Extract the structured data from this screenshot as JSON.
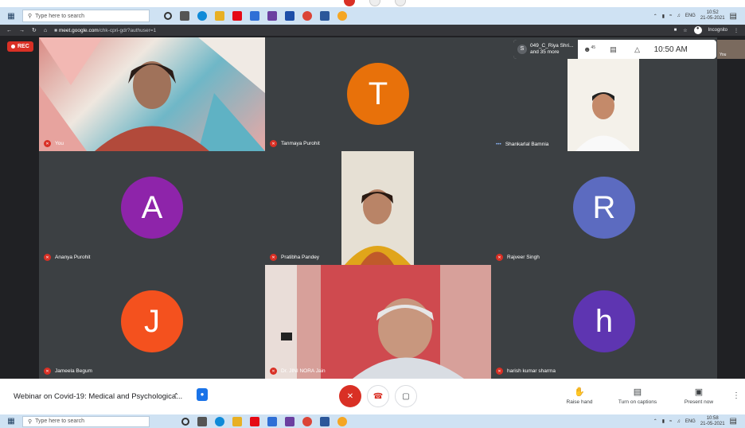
{
  "taskbar": {
    "search_placeholder": "Type here to search",
    "tray_lang": "ENG",
    "top_time": "10:52",
    "top_date": "21-05-2021",
    "bottom_time": "10:58",
    "bottom_date": "21-05-2021"
  },
  "browser": {
    "url_host": "meet.google.com",
    "url_path": "/chk-cpri-gdr?authuser=1",
    "incognito_label": "Incognito"
  },
  "meet": {
    "rec_label": "REC",
    "participants_line1": "049_C_Riya Shri...",
    "participants_line2": "and 35 more",
    "participants_initial": "S",
    "people_count": "45",
    "time": "10:50 AM",
    "self_view_label": "You",
    "tiles": [
      {
        "name": "You",
        "kind": "video"
      },
      {
        "name": "Tanmaya Purohit",
        "kind": "avatar",
        "initial": "T",
        "color": "#e8710a"
      },
      {
        "name": "Shankarlal Bamnia",
        "kind": "video"
      },
      {
        "name": "Ananya Purohit",
        "kind": "avatar",
        "initial": "A",
        "color": "#8e24aa"
      },
      {
        "name": "Pratibha Pandey",
        "kind": "video"
      },
      {
        "name": "Rajveer Singh",
        "kind": "avatar",
        "initial": "R",
        "color": "#5c6bc0"
      },
      {
        "name": "Jameela Begum",
        "kind": "avatar",
        "initial": "J",
        "color": "#f4511e"
      },
      {
        "name": "Dr. JINI NORA Jain",
        "kind": "video"
      },
      {
        "name": "harish kumar sharma",
        "kind": "avatar",
        "initial": "h",
        "color": "#5e35b1"
      }
    ]
  },
  "controls": {
    "meeting_title": "Webinar on Covid-19: Medical and Psychologica...",
    "raise_hand": "Raise hand",
    "captions": "Turn on captions",
    "present": "Present now"
  }
}
